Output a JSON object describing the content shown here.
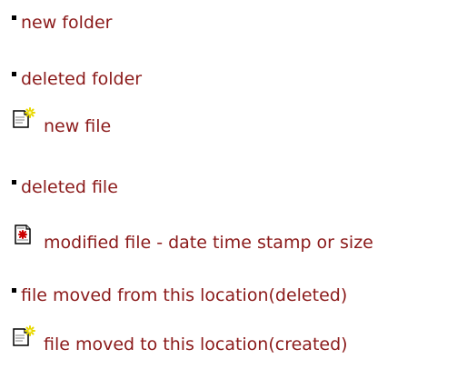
{
  "legend": {
    "items": [
      {
        "label": "new folder",
        "icon": "bullet-icon"
      },
      {
        "label": "deleted folder",
        "icon": "bullet-icon"
      },
      {
        "label": "new file",
        "icon": "new-file-icon"
      },
      {
        "label": "deleted file",
        "icon": "bullet-icon"
      },
      {
        "label": "modified file - date time stamp or size",
        "icon": "modified-file-icon"
      },
      {
        "label": "file moved from this location(deleted)",
        "icon": "bullet-icon"
      },
      {
        "label": "file moved to this location(created)",
        "icon": "new-file-icon"
      }
    ]
  },
  "colors": {
    "label": "#8b1a1a",
    "bullet": "#000000"
  }
}
